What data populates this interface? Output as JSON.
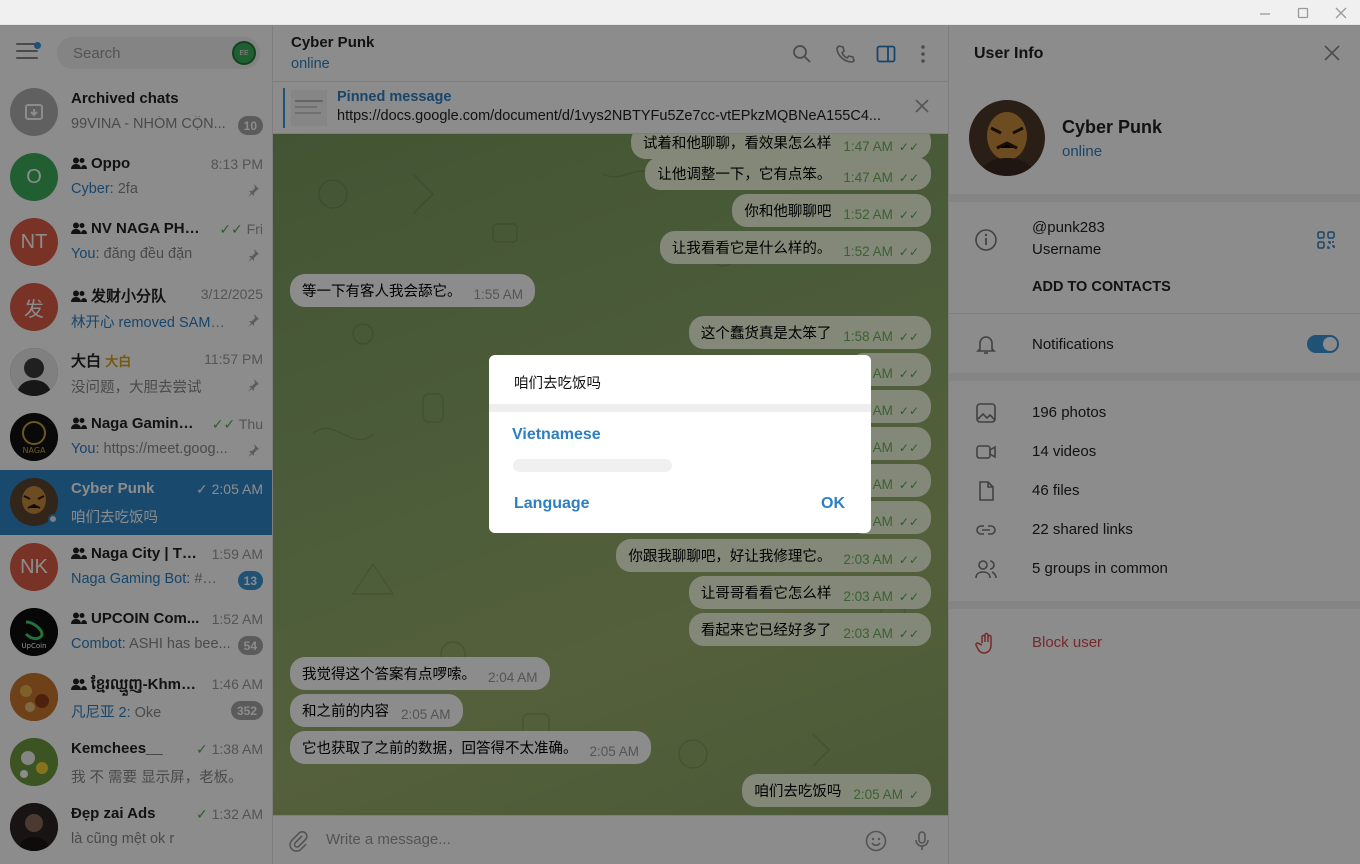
{
  "left": {
    "search_placeholder": "Search",
    "search_avatar": "EE",
    "chats": [
      {
        "name": "Archived chats",
        "preview": "99VINA - NHÓM CỘN...",
        "badge": "10",
        "avatar": "",
        "color": "#b0b0b0"
      },
      {
        "name": "Oppo",
        "time": "8:13 PM",
        "sender": "Cyber:",
        "preview": " 2fa",
        "avatar": "O",
        "color": "#3cae5b"
      },
      {
        "name": "NV NAGA PHẾ ( B...",
        "time": "Fri",
        "sender": "You:",
        "preview": " đăng đều đặn",
        "avatar": "NT",
        "color": "#dd5b45"
      },
      {
        "name": "发财小分队",
        "time": "3/12/2025",
        "sender": "林开心 removed SAMA...",
        "preview": "",
        "avatar": "发",
        "color": "#dd5b45"
      },
      {
        "name": "大白",
        "tag": "大白",
        "time": "11:57 PM",
        "preview": "没问题，大胆去尝试",
        "avatar": "",
        "color": "#555"
      },
      {
        "name": "Naga Gaming A...",
        "time": "Thu",
        "sender": "You:",
        "preview": " https://meet.goog...",
        "avatar": "",
        "color": "#222"
      },
      {
        "name": "Cyber Punk",
        "time": "2:05 AM",
        "preview": "咱们去吃饭吗",
        "avatar": "",
        "color": "#6b4f35"
      },
      {
        "name": "Naga City | Th...",
        "time": "1:59 AM",
        "sender": "Naga Gaming Bot:",
        "preview": " #RE...",
        "badge": "13",
        "avatar": "NK",
        "color": "#dd5b45"
      },
      {
        "name": "UPCOIN Com...",
        "time": "1:52 AM",
        "sender": "Combot:",
        "preview": " ASHI has bee...",
        "badge": "54",
        "avatar": "UpCoin",
        "color": "#111"
      },
      {
        "name": "ខែ្មរឈ្មួញ-Khme...",
        "time": "1:46 AM",
        "sender": "凡尼亚 2:",
        "preview": " Oke",
        "badge": "352",
        "avatar": "",
        "color": "#b5662f"
      },
      {
        "name": "Kemchees__",
        "time": "1:38 AM",
        "preview": "我 不 需要 显示屏，老板。",
        "avatar": "",
        "color": "#7aa24a"
      },
      {
        "name": "Đẹp zai Ads",
        "time": "1:32 AM",
        "preview": "là cũng mệt ok r",
        "avatar": "",
        "color": "#3a2f2f"
      }
    ]
  },
  "mid": {
    "title": "Cyber Punk",
    "status": "online",
    "pinned_title": "Pinned message",
    "pinned_url": "https://docs.google.com/document/d/1vys2NBTYFu5Ze7cc-vtEPkzMQBNeA155C4...",
    "input_placeholder": "Write a message...",
    "messages": [
      {
        "text": "试着和他聊聊，看效果怎么样",
        "time": "1:47 AM"
      },
      {
        "text": "让他调整一下，它有点笨。",
        "time": "1:47 AM"
      },
      {
        "text": "你和他聊聊吧",
        "time": "1:52 AM"
      },
      {
        "text": "让我看看它是什么样的。",
        "time": "1:52 AM"
      },
      {
        "text": "等一下有客人我会舔它。",
        "time": "1:55 AM"
      },
      {
        "text": "这个蠢货真是太笨了",
        "time": "1:58 AM"
      },
      {
        "text": "",
        "time": "AM"
      },
      {
        "text": "",
        "time": "AM"
      },
      {
        "text": "",
        "time": "AM"
      },
      {
        "text": "",
        "time": "AM"
      },
      {
        "text": "",
        "time": "AM"
      },
      {
        "text": "你跟我聊聊吧，好让我修理它。",
        "time": "2:03 AM"
      },
      {
        "text": "让哥哥看看它怎么样",
        "time": "2:03 AM"
      },
      {
        "text": "看起来它已经好多了",
        "time": "2:03 AM"
      },
      {
        "text": "我觉得这个答案有点啰嗦。",
        "time": "2:04 AM"
      },
      {
        "text": "和之前的内容",
        "time": "2:05 AM"
      },
      {
        "text": "它也获取了之前的数据，回答得不太准确。",
        "time": "2:05 AM"
      },
      {
        "text": "咱们去吃饭吗",
        "time": "2:05 AM"
      }
    ]
  },
  "dialog": {
    "text": "咱们去吃饭吗",
    "language": "Vietnamese",
    "language_button": "Language",
    "ok_button": "OK"
  },
  "right": {
    "title": "User Info",
    "name": "Cyber Punk",
    "status": "online",
    "username": "@punk283",
    "username_label": "Username",
    "add_contacts": "ADD TO CONTACTS",
    "notifications": "Notifications",
    "media": [
      "196 photos",
      "14 videos",
      "46 files",
      "22 shared links",
      "5 groups in common"
    ],
    "block": "Block user"
  },
  "colors": {
    "accent": "#2d7fc1",
    "active_row": "#2f88c8",
    "out_bubble": "#eef7dc",
    "danger": "#d64d4d"
  }
}
